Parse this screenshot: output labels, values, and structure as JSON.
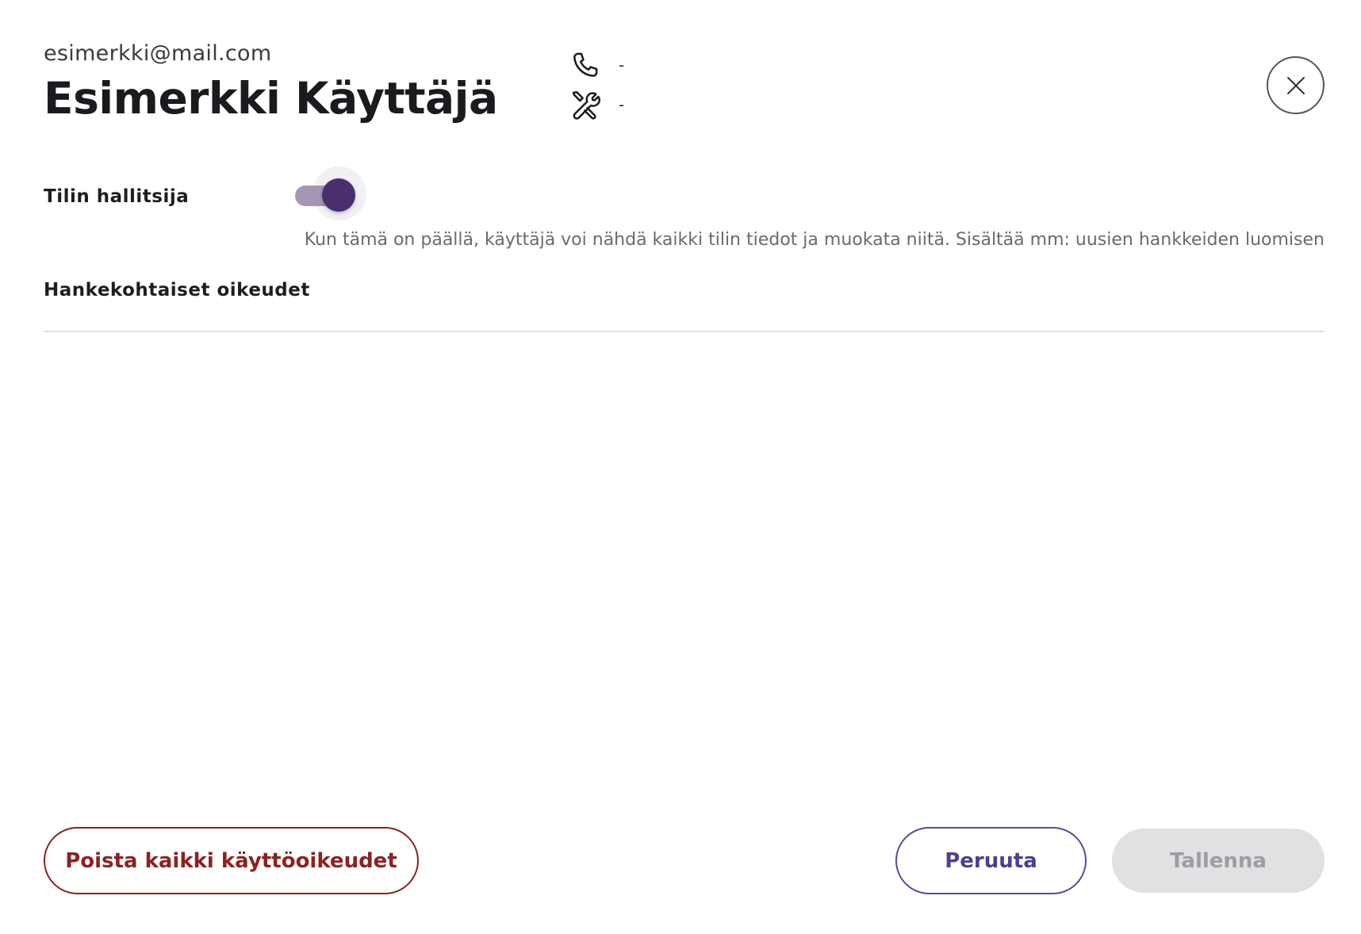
{
  "user": {
    "email": "esimerkki@mail.com",
    "name": "Esimerkki Käyttäjä"
  },
  "contact": {
    "phone": {
      "icon": "phone-icon",
      "value": "-"
    },
    "tool": {
      "icon": "tools-icon",
      "value": "-"
    }
  },
  "close": {
    "icon": "close-icon"
  },
  "admin": {
    "label": "Tilin hallitsija",
    "enabled": true,
    "description": "Kun tämä on päällä, käyttäjä voi nähdä kaikki tilin tiedot ja muokata niitä. Sisältää mm: uusien hankkeiden luomisen"
  },
  "project_permissions": {
    "label": "Hankekohtaiset oikeudet"
  },
  "actions": {
    "remove_label": "Poista kaikki käyttöoikeudet",
    "cancel_label": "Peruuta",
    "save_label": "Tallenna"
  },
  "colors": {
    "toggle_on": "#4b2e6e",
    "toggle_track": "#a497b6",
    "danger": "#8b2320",
    "primary": "#4e3f8f",
    "disabled_bg": "#e1e1e3"
  }
}
